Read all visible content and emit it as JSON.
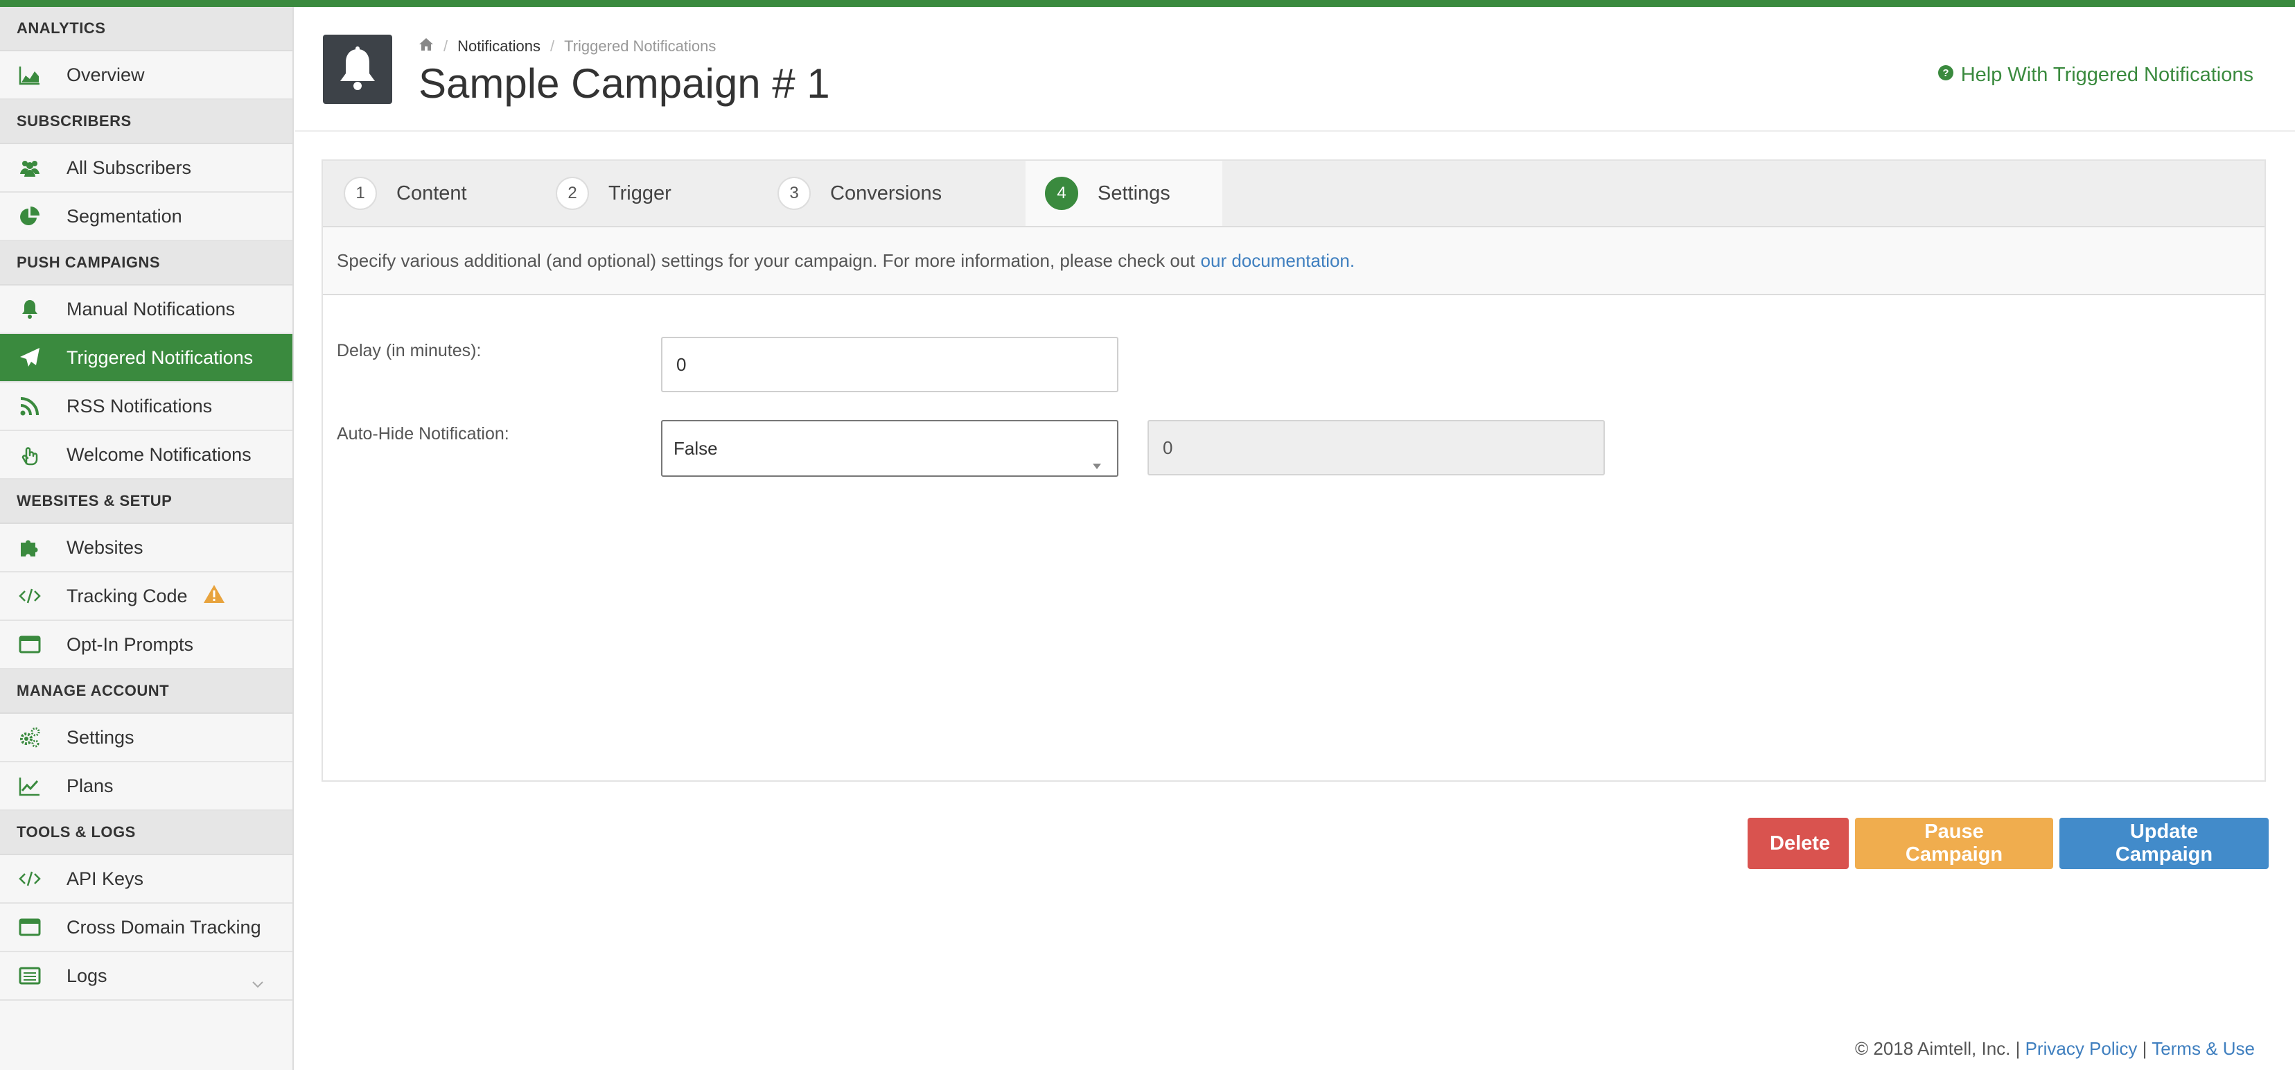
{
  "colors": {
    "brand_green": "#3a8a3e",
    "danger": "#d9534f",
    "warning": "#f0ad4e",
    "primary": "#428bca",
    "link": "#3f7fbf"
  },
  "sidebar": {
    "sections": [
      {
        "header": "ANALYTICS",
        "items": [
          {
            "label": "Overview",
            "icon": "area-chart-icon"
          }
        ]
      },
      {
        "header": "SUBSCRIBERS",
        "items": [
          {
            "label": "All Subscribers",
            "icon": "users-icon"
          },
          {
            "label": "Segmentation",
            "icon": "pie-chart-icon"
          }
        ]
      },
      {
        "header": "PUSH CAMPAIGNS",
        "items": [
          {
            "label": "Manual Notifications",
            "icon": "bell-icon"
          },
          {
            "label": "Triggered Notifications",
            "icon": "paper-plane-icon"
          },
          {
            "label": "RSS Notifications",
            "icon": "rss-icon"
          },
          {
            "label": "Welcome Notifications",
            "icon": "hand-icon"
          }
        ]
      },
      {
        "header": "WEBSITES & SETUP",
        "items": [
          {
            "label": "Websites",
            "icon": "puzzle-icon"
          },
          {
            "label": "Tracking Code",
            "icon": "code-icon"
          },
          {
            "label": "Opt-In Prompts",
            "icon": "window-icon"
          }
        ]
      },
      {
        "header": "MANAGE ACCOUNT",
        "items": [
          {
            "label": "Settings",
            "icon": "gears-icon"
          },
          {
            "label": "Plans",
            "icon": "line-chart-icon"
          }
        ]
      },
      {
        "header": "TOOLS & LOGS",
        "items": [
          {
            "label": "API Keys",
            "icon": "code-icon"
          },
          {
            "label": "Cross Domain Tracking",
            "icon": "window-icon"
          },
          {
            "label": "Logs",
            "icon": "list-icon"
          }
        ]
      }
    ],
    "active_item": "Triggered Notifications"
  },
  "header": {
    "breadcrumb": {
      "home_icon": "home-icon",
      "items": [
        "Notifications",
        "Triggered Notifications"
      ]
    },
    "title": "Sample Campaign # 1",
    "help_link": "Help With Triggered Notifications"
  },
  "wizard": {
    "tabs": [
      {
        "num": "1",
        "label": "Content"
      },
      {
        "num": "2",
        "label": "Trigger"
      },
      {
        "num": "3",
        "label": "Conversions"
      },
      {
        "num": "4",
        "label": "Settings"
      }
    ],
    "active_tab": "4",
    "description": "Specify various additional (and optional) settings for your campaign. For more information, please check out",
    "description_link": "our documentation."
  },
  "form": {
    "delay_label": "Delay (in minutes):",
    "delay_value": "0",
    "autohide_label": "Auto-Hide Notification:",
    "autohide_value": "False",
    "autohide_seconds": "0"
  },
  "actions": {
    "delete": "Delete",
    "pause": "Pause Campaign",
    "update": "Update Campaign"
  },
  "footer": {
    "copyright": "© 2018 Aimtell, Inc. |",
    "privacy": "Privacy Policy",
    "sep": "|",
    "terms": "Terms & Use"
  }
}
